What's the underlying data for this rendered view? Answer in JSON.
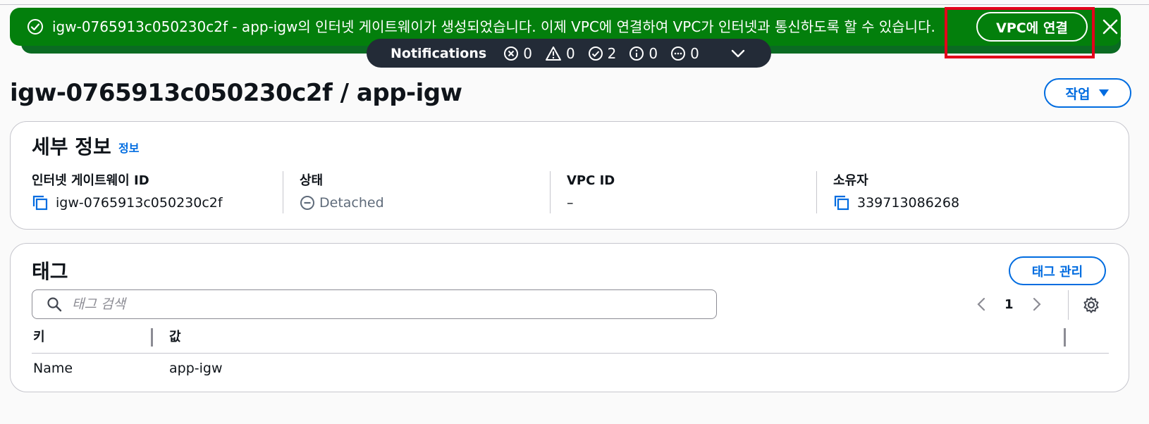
{
  "flash": {
    "message": "igw-0765913c050230c2f - app-igw의 인터넷 게이트웨이가 생성되었습니다. 이제 VPC에 연결하여 VPC가 인터넷과 통신하도록 할 수 있습니다.",
    "action_label": "VPC에 연결",
    "status_color": "#037f0c"
  },
  "notifications": {
    "title": "Notifications",
    "counts": {
      "error": "0",
      "warning": "0",
      "success": "2",
      "info": "0",
      "in_progress": "0"
    }
  },
  "page": {
    "title": "igw-0765913c050230c2f / app-igw",
    "actions_label": "작업"
  },
  "details": {
    "heading": "세부 정보",
    "info_link": "정보",
    "fields": [
      {
        "label": "인터넷 게이트웨이 ID",
        "value": "igw-0765913c050230c2f"
      },
      {
        "label": "상태",
        "value": "Detached"
      },
      {
        "label": "VPC ID",
        "value": "–"
      },
      {
        "label": "소유자",
        "value": "339713086268"
      }
    ]
  },
  "tags": {
    "heading": "태그",
    "manage_label": "태그 관리",
    "search_placeholder": "태그 검색",
    "page_number": "1",
    "columns": [
      "키",
      "값"
    ],
    "rows": [
      {
        "key": "Name",
        "value": "app-igw"
      }
    ]
  },
  "colors": {
    "accent": "#006ce0",
    "success": "#037f0c",
    "highlight": "#e3001b"
  }
}
